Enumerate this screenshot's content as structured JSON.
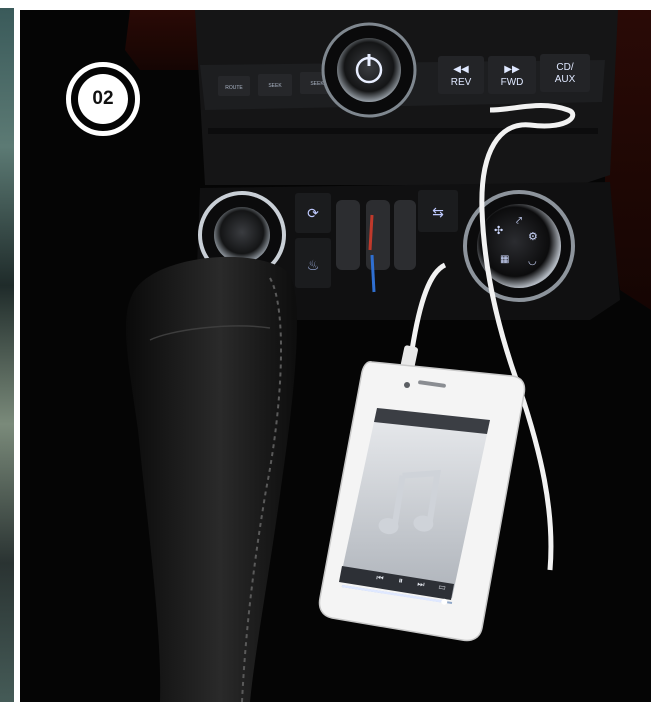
{
  "badge": {
    "number": "02"
  },
  "radio_buttons": {
    "rev_icon": "rewind-icon",
    "rev_label": "REV",
    "fwd_icon": "fast-forward-icon",
    "fwd_label": "FWD",
    "cd_line1": "CD/",
    "cd_line2": "AUX",
    "small_labels": [
      "ROUTE",
      "SEEK",
      "SEEK"
    ]
  },
  "phone": {
    "icon": "music-note-icon",
    "progress": 0.93,
    "controls": [
      "previous-track-icon",
      "pause-icon",
      "next-track-icon",
      "airplay-icon"
    ]
  },
  "colors": {
    "badge": "#ffffff",
    "cable": "#f2f2f2",
    "panel": "#151516",
    "button_glow": "#dfe8ff"
  }
}
